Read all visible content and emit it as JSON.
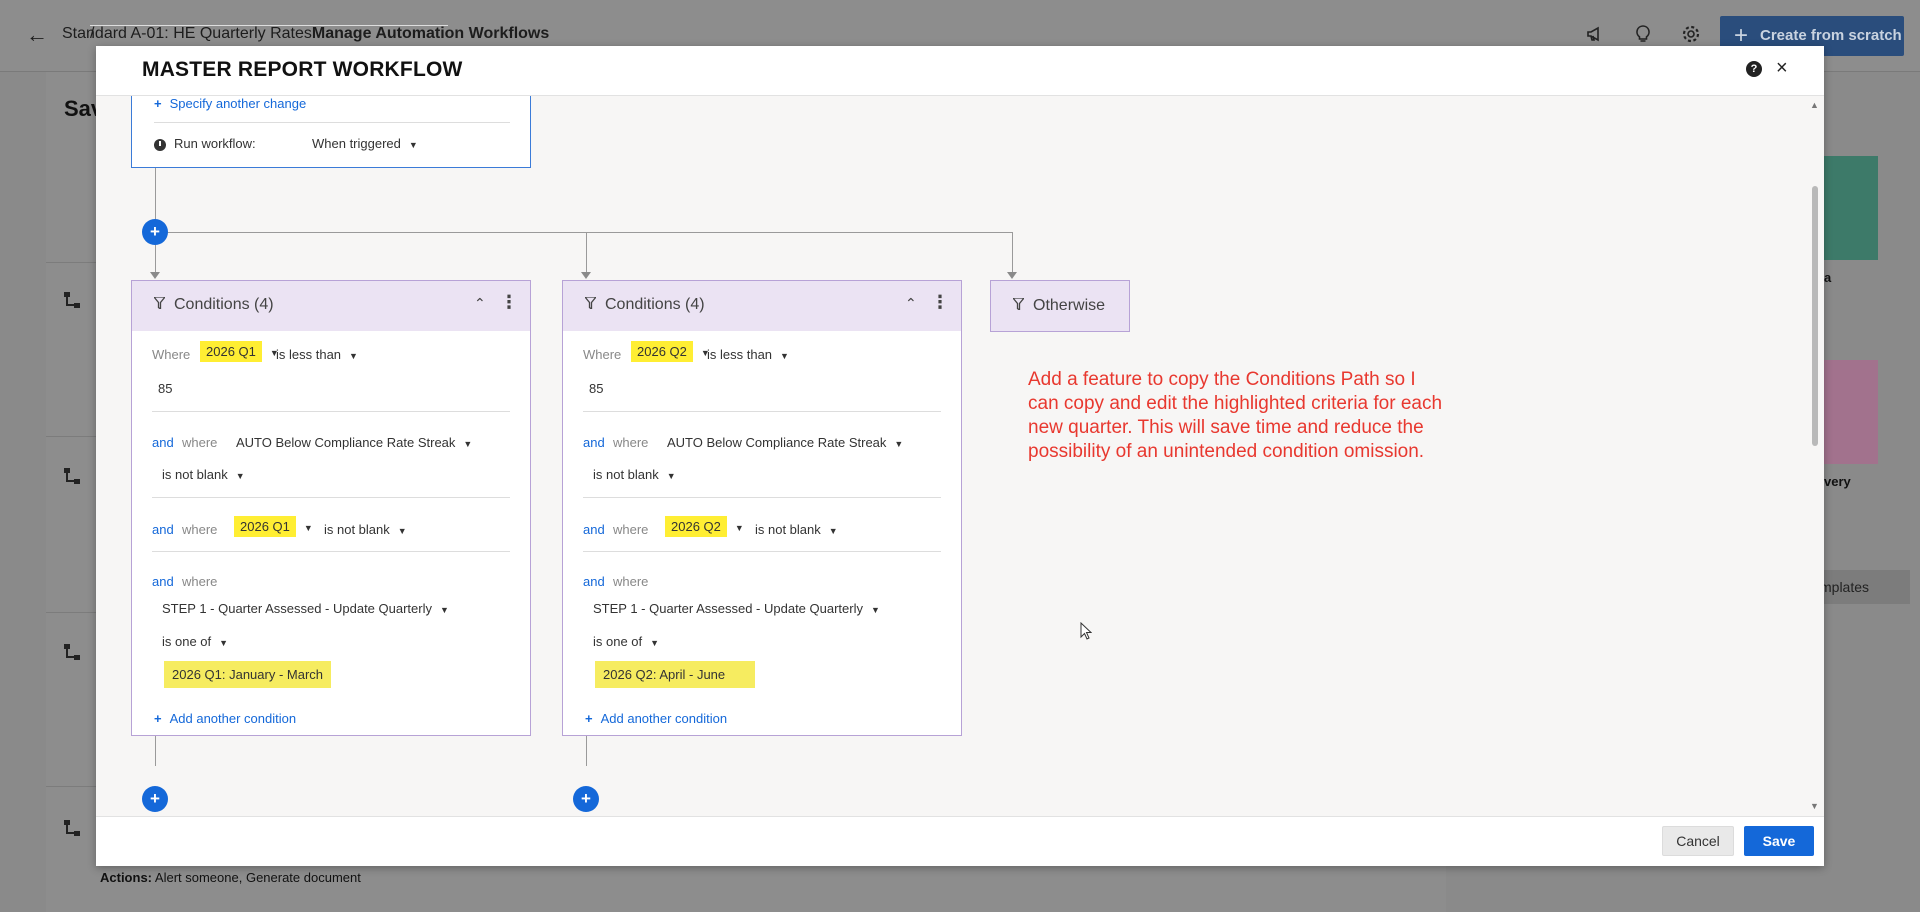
{
  "background": {
    "back_icon": "arrow-left-icon",
    "breadcrumb": {
      "parent": "Standard A-01: HE Quarterly Rates",
      "separator": "/",
      "current": "Manage Automation Workflows"
    },
    "header_icons": [
      "megaphone-icon",
      "lightbulb-icon",
      "gear-icon"
    ],
    "create_button": "Create from scratch",
    "page_title_partial": "Sav",
    "actions_label": "Actions:",
    "actions_value": "Alert someone, Generate document",
    "side_labels": [
      "a",
      "very"
    ],
    "templates_button": "mplates"
  },
  "modal": {
    "title": "MASTER REPORT WORKFLOW",
    "help_icon": "?",
    "close_icon": "×",
    "cancel_label": "Cancel",
    "save_label": "Save"
  },
  "trigger_card": {
    "specify_label": "Specify another change",
    "run_label": "Run workflow:",
    "run_value": "When triggered"
  },
  "conditions": [
    {
      "title": "Conditions (4)",
      "where_label": "Where",
      "c1_field": "2026 Q1",
      "c1_op": "is less than",
      "c1_value": "85",
      "and_label": "and",
      "where_lower": "where",
      "c2_field": "AUTO Below Compliance Rate Streak",
      "c2_op": "is not blank",
      "c3_field": "2026 Q1",
      "c3_op": "is not blank",
      "c4_field": "STEP 1 - Quarter Assessed - Update Quarterly",
      "c4_op": "is one of",
      "c4_value": "2026 Q1: January - March",
      "add_label": "Add another condition"
    },
    {
      "title": "Conditions (4)",
      "where_label": "Where",
      "c1_field": "2026 Q2",
      "c1_op": "is less than",
      "c1_value": "85",
      "and_label": "and",
      "where_lower": "where",
      "c2_field": "AUTO Below Compliance Rate Streak",
      "c2_op": "is not blank",
      "c3_field": "2026 Q2",
      "c3_op": "is not blank",
      "c4_field": "STEP 1 - Quarter Assessed - Update Quarterly",
      "c4_op": "is one of",
      "c4_value": "2026 Q2: April - June",
      "add_label": "Add another condition"
    }
  ],
  "otherwise_label": "Otherwise",
  "annotation": "Add a feature to copy the Conditions Path so I can copy and edit the highlighted criteria for each new quarter. This will save time and reduce the possibility of an unintended condition omission.",
  "colors": {
    "accent": "#1468d9",
    "highlight": "#ffee33",
    "annotation": "#e8382f",
    "condition_header": "#ebe3f3"
  }
}
